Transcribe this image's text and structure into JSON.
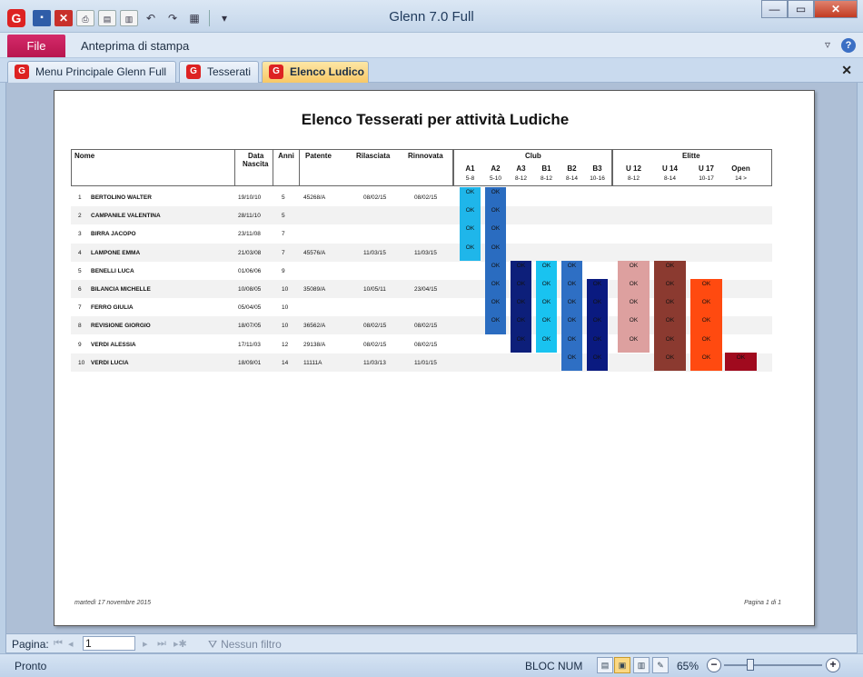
{
  "window": {
    "title": "Glenn 7.0 Full"
  },
  "ribbon": {
    "file_label": "File",
    "tab_label": "Anteprima di stampa"
  },
  "doc_tabs": [
    {
      "label": "Menu Principale Glenn Full"
    },
    {
      "label": "Tesserati"
    },
    {
      "label": "Elenco Ludico"
    }
  ],
  "report": {
    "title": "Elenco Tesserati per attività Ludiche",
    "headers": {
      "nome": "Nome",
      "data_nascita_1": "Data",
      "data_nascita_2": "Nascita",
      "anni": "Anni",
      "patente": "Patente",
      "rilasciata": "Rilasciata",
      "rinnovata": "Rinnovata",
      "club": "Club",
      "elitte": "Elitte"
    },
    "activities": [
      {
        "code": "A1",
        "range": "5-8",
        "group": "club",
        "color": "#1fb6ea"
      },
      {
        "code": "A2",
        "range": "5-10",
        "group": "club",
        "color": "#2a6cc0"
      },
      {
        "code": "A3",
        "range": "8-12",
        "group": "club",
        "color": "#0d1f7a"
      },
      {
        "code": "B1",
        "range": "8-12",
        "group": "club",
        "color": "#19c3f0"
      },
      {
        "code": "B2",
        "range": "8-14",
        "group": "club",
        "color": "#2e6fc4"
      },
      {
        "code": "B3",
        "range": "10-16",
        "group": "club",
        "color": "#0a1a80"
      },
      {
        "code": "U 12",
        "range": "8-12",
        "group": "elitte",
        "color": "#dda09f"
      },
      {
        "code": "U 14",
        "range": "8-14",
        "group": "elitte",
        "color": "#8b3a30"
      },
      {
        "code": "U 17",
        "range": "10-17",
        "group": "elitte",
        "color": "#ff4a10"
      },
      {
        "code": "Open",
        "range": "14 >",
        "group": "elitte",
        "color": "#a00a1e"
      }
    ],
    "ok_label": "OK",
    "rows": [
      {
        "n": "1",
        "name": "BERTOLINO WALTER",
        "birth": "19/10/10",
        "age": "5",
        "license": "45268/A",
        "issued": "08/02/15",
        "renewed": "08/02/15",
        "acts": [
          0,
          1
        ]
      },
      {
        "n": "2",
        "name": "CAMPANILE VALENTINA",
        "birth": "28/11/10",
        "age": "5",
        "license": "",
        "issued": "",
        "renewed": "",
        "acts": [
          0,
          1
        ]
      },
      {
        "n": "3",
        "name": "BIRRA JACOPO",
        "birth": "23/11/08",
        "age": "7",
        "license": "",
        "issued": "",
        "renewed": "",
        "acts": [
          0,
          1
        ]
      },
      {
        "n": "4",
        "name": "LAMPONE EMMA",
        "birth": "21/03/08",
        "age": "7",
        "license": "45576/A",
        "issued": "11/03/15",
        "renewed": "11/03/15",
        "acts": [
          0,
          1
        ]
      },
      {
        "n": "5",
        "name": "BENELLI LUCA",
        "birth": "01/06/06",
        "age": "9",
        "license": "",
        "issued": "",
        "renewed": "",
        "acts": [
          1,
          2,
          3,
          4,
          6,
          7
        ]
      },
      {
        "n": "6",
        "name": "BILANCIA MICHELLE",
        "birth": "10/08/05",
        "age": "10",
        "license": "35089/A",
        "issued": "10/05/11",
        "renewed": "23/04/15",
        "acts": [
          1,
          2,
          3,
          4,
          5,
          6,
          7,
          8
        ]
      },
      {
        "n": "7",
        "name": "FERRO GIULIA",
        "birth": "05/04/05",
        "age": "10",
        "license": "",
        "issued": "",
        "renewed": "",
        "acts": [
          1,
          2,
          3,
          4,
          5,
          6,
          7,
          8
        ]
      },
      {
        "n": "8",
        "name": "REVISIONE GIORGIO",
        "birth": "18/07/05",
        "age": "10",
        "license": "36562/A",
        "issued": "08/02/15",
        "renewed": "08/02/15",
        "acts": [
          1,
          2,
          3,
          4,
          5,
          6,
          7,
          8
        ]
      },
      {
        "n": "9",
        "name": "VERDI ALESSIA",
        "birth": "17/11/03",
        "age": "12",
        "license": "29138/A",
        "issued": "08/02/15",
        "renewed": "08/02/15",
        "acts": [
          2,
          3,
          4,
          5,
          6,
          7,
          8
        ]
      },
      {
        "n": "10",
        "name": "VERDI LUCIA",
        "birth": "18/09/01",
        "age": "14",
        "license": "11111A",
        "issued": "11/03/13",
        "renewed": "11/01/15",
        "acts": [
          4,
          5,
          7,
          8,
          9
        ]
      }
    ],
    "footer_date": "martedì 17 novembre 2015",
    "footer_page": "Pagina 1 di 1"
  },
  "navigator": {
    "label": "Pagina:",
    "page_value": "1",
    "filter_label": "Nessun filtro"
  },
  "status": {
    "text": "Pronto",
    "numlock": "BLOC NUM",
    "zoom": "65%",
    "zoom_level": 0.27
  }
}
